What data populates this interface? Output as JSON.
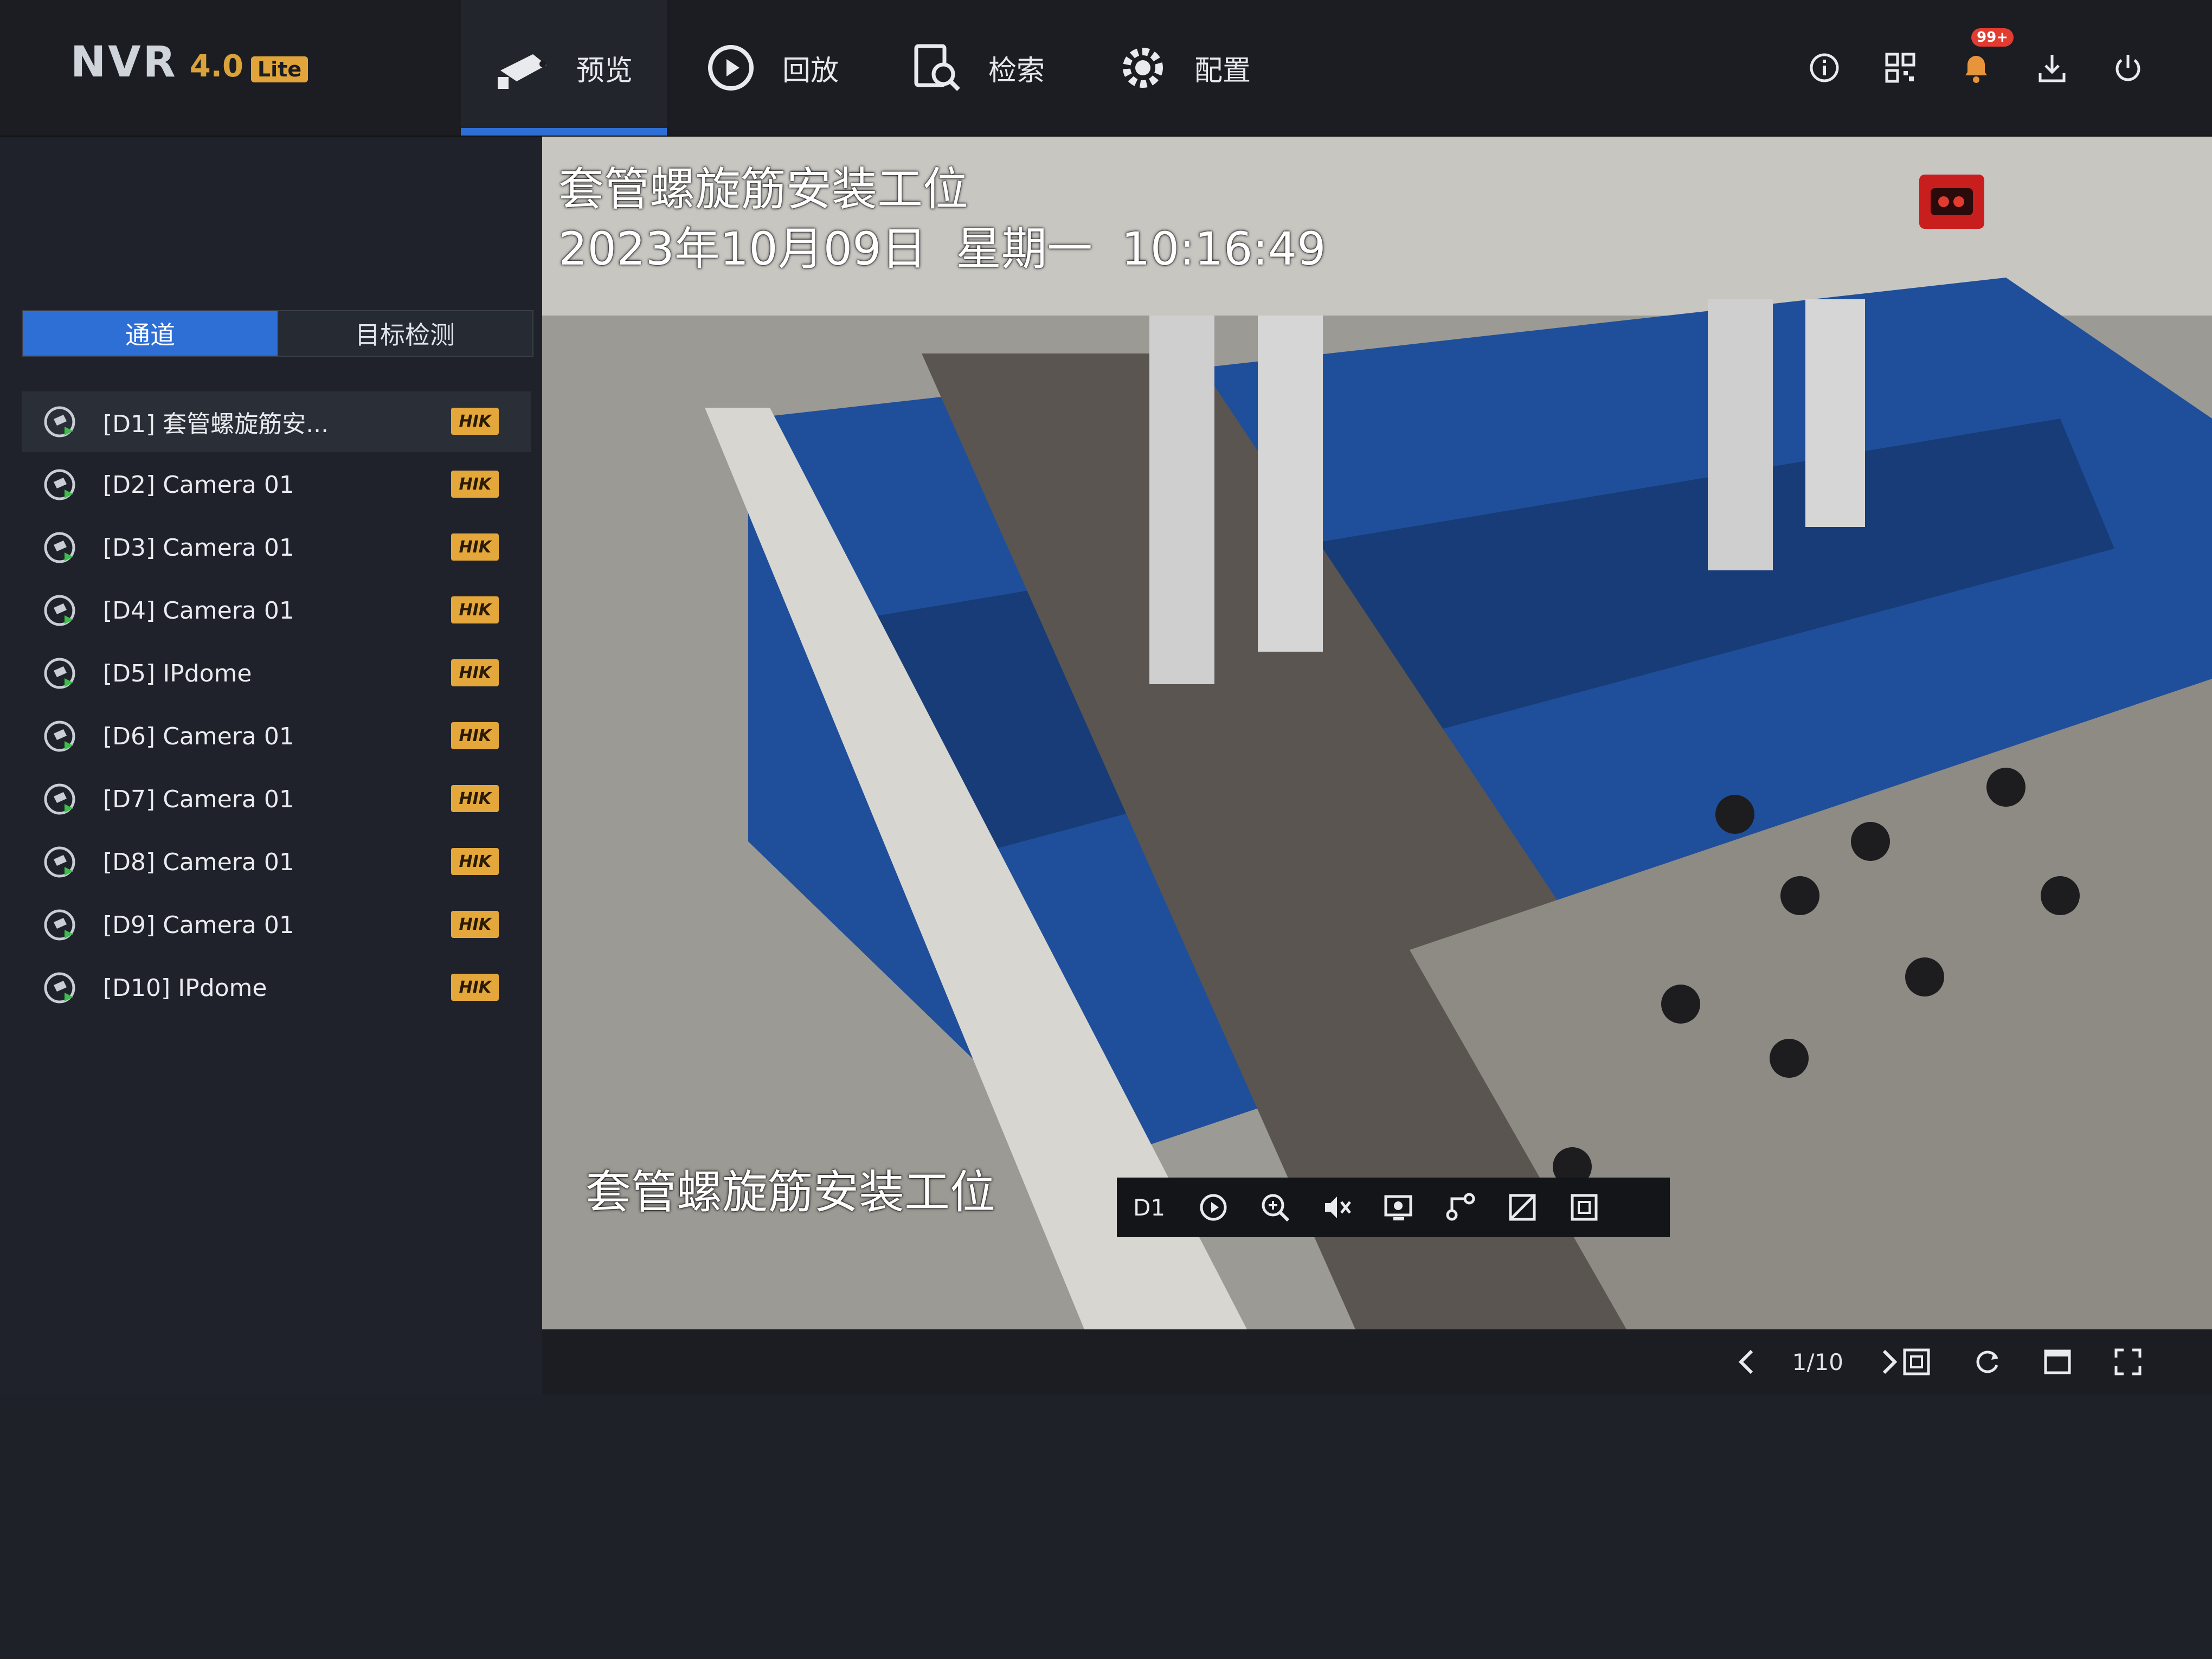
{
  "app": {
    "logo": "NVR",
    "version": "4.0",
    "edition": "Lite"
  },
  "menu": [
    {
      "label": "预览",
      "icon": "camera-icon",
      "active": true
    },
    {
      "label": "回放",
      "icon": "playback-icon",
      "active": false
    },
    {
      "label": "检索",
      "icon": "search-icon",
      "active": false
    },
    {
      "label": "配置",
      "icon": "gear-icon",
      "active": false
    }
  ],
  "toolbar": {
    "notification_count": "99+",
    "icons": [
      "info-icon",
      "qrcode-icon",
      "bell-icon",
      "download-icon",
      "power-icon"
    ]
  },
  "sidebar": {
    "tabs": [
      {
        "label": "通道",
        "active": true
      },
      {
        "label": "目标检测",
        "active": false
      }
    ],
    "channels": [
      {
        "label": "[D1] 套管螺旋筋安...",
        "badge": "HIK",
        "selected": true
      },
      {
        "label": "[D2] Camera 01",
        "badge": "HIK"
      },
      {
        "label": "[D3] Camera 01",
        "badge": "HIK"
      },
      {
        "label": "[D4] Camera 01",
        "badge": "HIK"
      },
      {
        "label": "[D5] IPdome",
        "badge": "HIK"
      },
      {
        "label": "[D6] Camera 01",
        "badge": "HIK"
      },
      {
        "label": "[D7] Camera 01",
        "badge": "HIK"
      },
      {
        "label": "[D8] Camera 01",
        "badge": "HIK"
      },
      {
        "label": "[D9] Camera 01",
        "badge": "HIK"
      },
      {
        "label": "[D10] IPdome",
        "badge": "HIK"
      }
    ]
  },
  "video": {
    "osd_title": "套管螺旋筋安装工位",
    "osd_datetime": "2023年10月09日  星期一  10:16:49",
    "osd_bottom": "套管螺旋筋安装工位",
    "channel_label": "D1",
    "toolbar_icons": [
      "instant-playback-icon",
      "zoom-icon",
      "mute-icon",
      "capture-icon",
      "ptz-icon",
      "stream-icon",
      "fullscreen-window-icon"
    ]
  },
  "bottombar": {
    "page": "1/10",
    "icons": [
      "layout-icon",
      "refresh-icon",
      "single-window-icon",
      "fullscreen-icon"
    ]
  },
  "colors": {
    "accent": "#2e6fd6",
    "badge": "#e3a73b",
    "alert": "#e23b30",
    "bar": "#1b1d22"
  }
}
